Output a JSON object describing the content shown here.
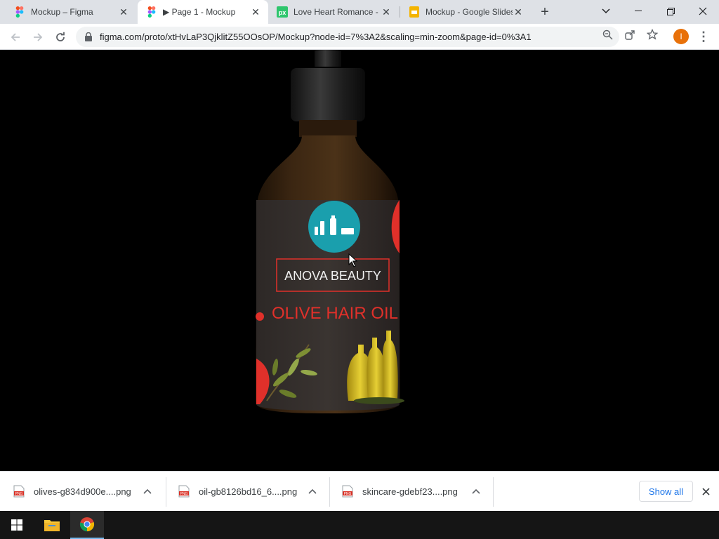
{
  "browser": {
    "tabs": [
      {
        "title": "Mockup – Figma",
        "icon": "figma-icon",
        "active": false
      },
      {
        "title": "▶ Page 1 - Mockup",
        "icon": "figma-icon",
        "active": true
      },
      {
        "title": "Love Heart Romance -",
        "icon": "pixabay-icon",
        "active": false
      },
      {
        "title": "Mockup - Google Slides",
        "icon": "google-slides-icon",
        "active": false
      }
    ],
    "url": "figma.com/proto/xtHvLaP3QjklitZ55OOsOP/Mockup?node-id=7%3A2&scaling=min-zoom&page-id=0%3A1",
    "profile_initial": "I",
    "profile_color": "#e8710a"
  },
  "content": {
    "brand": "ANOVA BEAUTY",
    "product": "OLIVE HAIR OIL"
  },
  "downloads": {
    "items": [
      {
        "name": "olives-g834d900e....png",
        "type": "PNG"
      },
      {
        "name": "oil-gb8126bd16_6....png",
        "type": "PNG"
      },
      {
        "name": "skincare-gdebf23....png",
        "type": "PNG"
      }
    ],
    "show_all_label": "Show all"
  },
  "colors": {
    "accent": "#1a73e8",
    "label_red": "#e0302a",
    "teal_badge": "#1a9fad"
  }
}
